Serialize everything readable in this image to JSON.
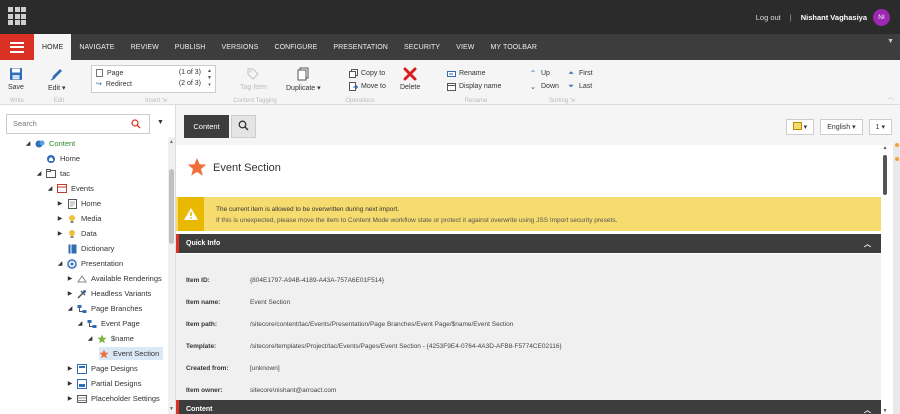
{
  "topbar": {
    "logout": "Log out",
    "separator": "|",
    "user_name": "Nishant Vaghasiya",
    "avatar_initials": "NI"
  },
  "tabs": [
    {
      "label": "HOME",
      "active": true
    },
    {
      "label": "NAVIGATE"
    },
    {
      "label": "REVIEW"
    },
    {
      "label": "PUBLISH"
    },
    {
      "label": "VERSIONS"
    },
    {
      "label": "CONFIGURE"
    },
    {
      "label": "PRESENTATION"
    },
    {
      "label": "SECURITY"
    },
    {
      "label": "VIEW"
    },
    {
      "label": "MY TOOLBAR"
    }
  ],
  "ribbon": {
    "write": {
      "save": "Save",
      "group": "Write"
    },
    "edit": {
      "edit": "Edit",
      "group": "Edit"
    },
    "insert": {
      "items": [
        {
          "label": "Page",
          "count": "(1 of 3)"
        },
        {
          "label": "Redirect",
          "count": "(2 of 3)"
        }
      ],
      "group": "Insert"
    },
    "content_tagging": {
      "tag_item": "Tag Item",
      "group": "Content Tagging"
    },
    "operations": {
      "duplicate": "Duplicate",
      "copy_to": "Copy to",
      "move_to": "Move to",
      "delete": "Delete",
      "group": "Operations"
    },
    "rename": {
      "rename": "Rename",
      "display_name": "Display name",
      "group": "Rename"
    },
    "sorting": {
      "up": "Up",
      "down": "Down",
      "first": "First",
      "last": "Last",
      "group": "Sorting"
    }
  },
  "tree": {
    "search_placeholder": "Search",
    "nodes": [
      {
        "label": "Content",
        "level": 0,
        "arrow": "open",
        "icon": "content-icon"
      },
      {
        "label": "Home",
        "level": 1,
        "arrow": "none",
        "icon": "home-icon"
      },
      {
        "label": "tac",
        "level": 1,
        "arrow": "open",
        "icon": "folder-icon"
      },
      {
        "label": "Events",
        "level": 2,
        "arrow": "open",
        "icon": "events-icon"
      },
      {
        "label": "Home",
        "level": 3,
        "arrow": "closed",
        "icon": "page-icon"
      },
      {
        "label": "Media",
        "level": 3,
        "arrow": "closed",
        "icon": "media-icon"
      },
      {
        "label": "Data",
        "level": 3,
        "arrow": "closed",
        "icon": "data-icon"
      },
      {
        "label": "Dictionary",
        "level": 3,
        "arrow": "none",
        "icon": "dictionary-icon"
      },
      {
        "label": "Presentation",
        "level": 3,
        "arrow": "open",
        "icon": "presentation-icon"
      },
      {
        "label": "Available Renderings",
        "level": 4,
        "arrow": "closed",
        "icon": "renderings-icon"
      },
      {
        "label": "Headless Variants",
        "level": 4,
        "arrow": "closed",
        "icon": "variants-icon"
      },
      {
        "label": "Page Branches",
        "level": 4,
        "arrow": "open",
        "icon": "branches-icon"
      },
      {
        "label": "Event Page",
        "level": 5,
        "arrow": "open",
        "icon": "branch-icon"
      },
      {
        "label": "$name",
        "level": 6,
        "arrow": "open",
        "icon": "star-green-icon"
      },
      {
        "label": "Event Section",
        "level": 7,
        "arrow": "none",
        "icon": "star-orange-icon",
        "selected": true
      },
      {
        "label": "Page Designs",
        "level": 4,
        "arrow": "closed",
        "icon": "page-designs-icon"
      },
      {
        "label": "Partial Designs",
        "level": 4,
        "arrow": "closed",
        "icon": "partial-designs-icon"
      },
      {
        "label": "Placeholder Settings",
        "level": 4,
        "arrow": "closed",
        "icon": "placeholder-icon"
      }
    ]
  },
  "editor": {
    "content_tab": "Content",
    "language": "English",
    "version": "1",
    "item_title": "Event Section",
    "warning_title": "The current item is allowed to be overwritten during next import.",
    "warning_text": "If this is unexpected, please move the item to Content Mode workflow state or protect it against overwrite using JSS Import security presets.",
    "quick_info_label": "Quick Info",
    "quick_info": [
      {
        "key": "Item ID:",
        "value": "{804E1797-A94B-4189-A43A-757A6E01F514}"
      },
      {
        "key": "Item name:",
        "value": "Event Section"
      },
      {
        "key": "Item path:",
        "value": "/sitecore/content/tac/Events/Presentation/Page Branches/Event Page/$name/Event Section"
      },
      {
        "key": "Template:",
        "value": "/sitecore/templates/Project/tac/Events/Pages/Event Section - {4253F9E4-0764-4A3D-AFB8-F5774CE02116}"
      },
      {
        "key": "Created from:",
        "value": "[unknown]"
      },
      {
        "key": "Item owner:",
        "value": "sitecore\\nishant@arroact.com"
      }
    ],
    "content_section_label": "Content"
  },
  "colors": {
    "accent_red": "#db3124",
    "dark_bar": "#2b2b2b",
    "warning_yellow": "#f6db6e",
    "avatar_purple": "#9c27b0"
  }
}
